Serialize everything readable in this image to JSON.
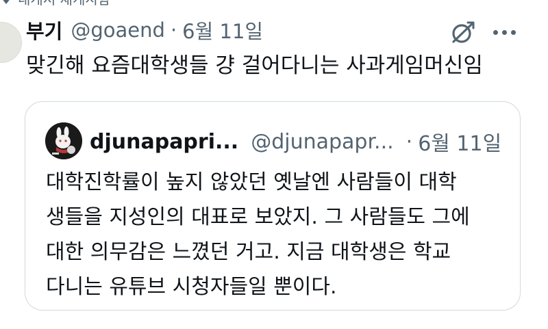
{
  "context": {
    "text": "내게서 재게시함"
  },
  "tweet": {
    "author_name": "부기",
    "author_handle": "@goaend",
    "separator": "·",
    "date": "6월 11일",
    "text": "맞긴해 요즘대학생들 걍 걸어다니는 사과게임머신임",
    "icons": [
      "grok-icon",
      "more-icon"
    ]
  },
  "quote": {
    "author_name": "djunapapri...",
    "author_handle": "@djunapapr...",
    "separator": "·",
    "date": "6월 11일",
    "lines": [
      "대학진학률이 높지 않았던 옛날엔 사람들이 대학",
      "생들을 지성인의 대표로 보았지. 그 사람들도 그에",
      "대한 의무감은 느꼈던 거고. 지금 대학생은 학교",
      "다니는 유튜브 시청자들일 뿐이다."
    ]
  },
  "colors": {
    "text_primary": "#0f1419",
    "text_secondary": "#536471",
    "border": "#cfd9de",
    "background": "#ffffff"
  }
}
